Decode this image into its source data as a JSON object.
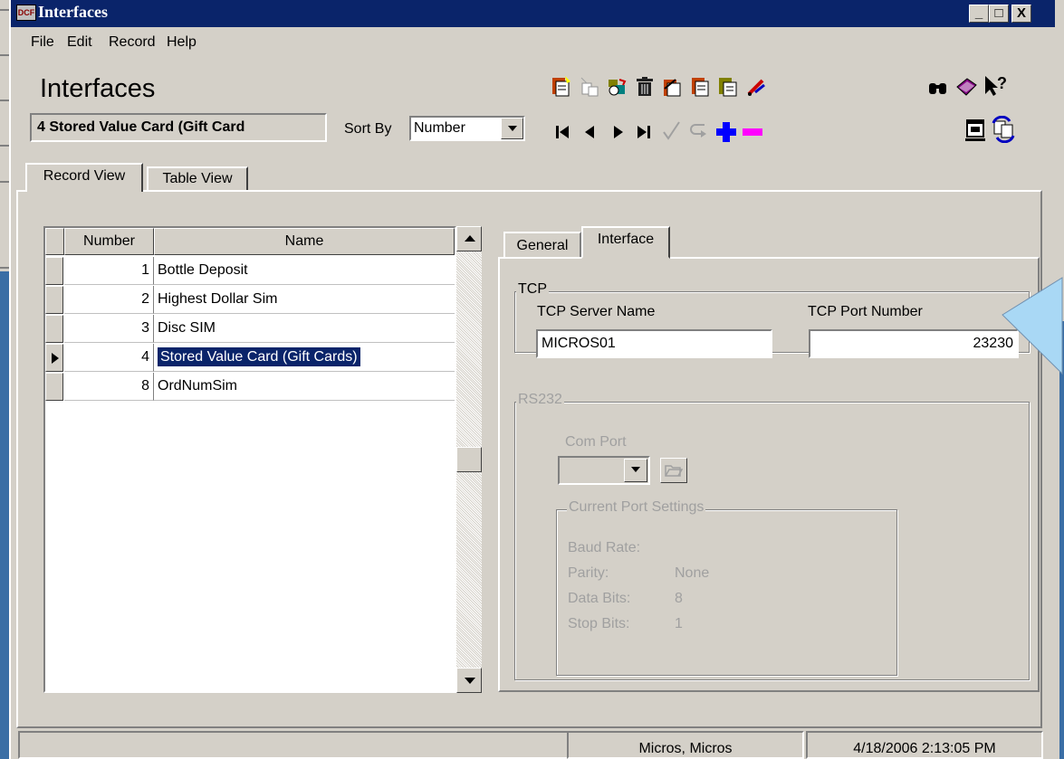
{
  "window": {
    "title": "Interfaces",
    "minimize": "_",
    "maximize": "□",
    "close": "X"
  },
  "menu": [
    "File",
    "Edit",
    "Record",
    "Help"
  ],
  "header": {
    "page_title": "Interfaces",
    "current_record": "4 Stored Value Card (Gift Card",
    "sort_by_label": "Sort By",
    "sort_by_value": "Number"
  },
  "view_tabs": [
    "Record View",
    "Table View"
  ],
  "grid": {
    "columns": [
      "Number",
      "Name"
    ],
    "rows": [
      {
        "number": "1",
        "name": "Bottle Deposit"
      },
      {
        "number": "2",
        "name": "Highest Dollar Sim"
      },
      {
        "number": "3",
        "name": "Disc SIM"
      },
      {
        "number": "4",
        "name": "Stored Value Card (Gift Cards)"
      },
      {
        "number": "8",
        "name": "OrdNumSim"
      }
    ],
    "selected_row": 4
  },
  "detail_tabs": [
    "General",
    "Interface"
  ],
  "tcp": {
    "group_label": "TCP",
    "server_name_label": "TCP Server Name",
    "server_name_value": "MICROS01",
    "port_label": "TCP Port Number",
    "port_value": "23230"
  },
  "rs232": {
    "group_label": "RS232",
    "com_port_label": "Com Port",
    "settings_label": "Current Port Settings",
    "baud_label": "Baud Rate:",
    "baud_value": "",
    "parity_label": "Parity:",
    "parity_value": "None",
    "data_bits_label": "Data Bits:",
    "data_bits_value": "8",
    "stop_bits_label": "Stop Bits:",
    "stop_bits_value": "1"
  },
  "status": {
    "user": "Micros, Micros",
    "datetime": "4/18/2006 2:13:05 PM"
  },
  "colors": {
    "titlebar": "#0a246a",
    "face": "#d4d0c8",
    "desktop": "#3a6ea5",
    "callout": "#a9d8f5"
  },
  "icons": [
    "new-record-icon",
    "copy-icon",
    "import-icon",
    "delete-icon",
    "clipboard-icon",
    "edit-record-icon",
    "paste-icon",
    "cut-icon",
    "binoculars-icon",
    "book-icon",
    "help-pointer-icon",
    "first-icon",
    "prev-icon",
    "next-icon",
    "last-icon",
    "check-icon",
    "undo-icon",
    "add-icon",
    "remove-icon",
    "window-icon",
    "refresh-icon"
  ]
}
